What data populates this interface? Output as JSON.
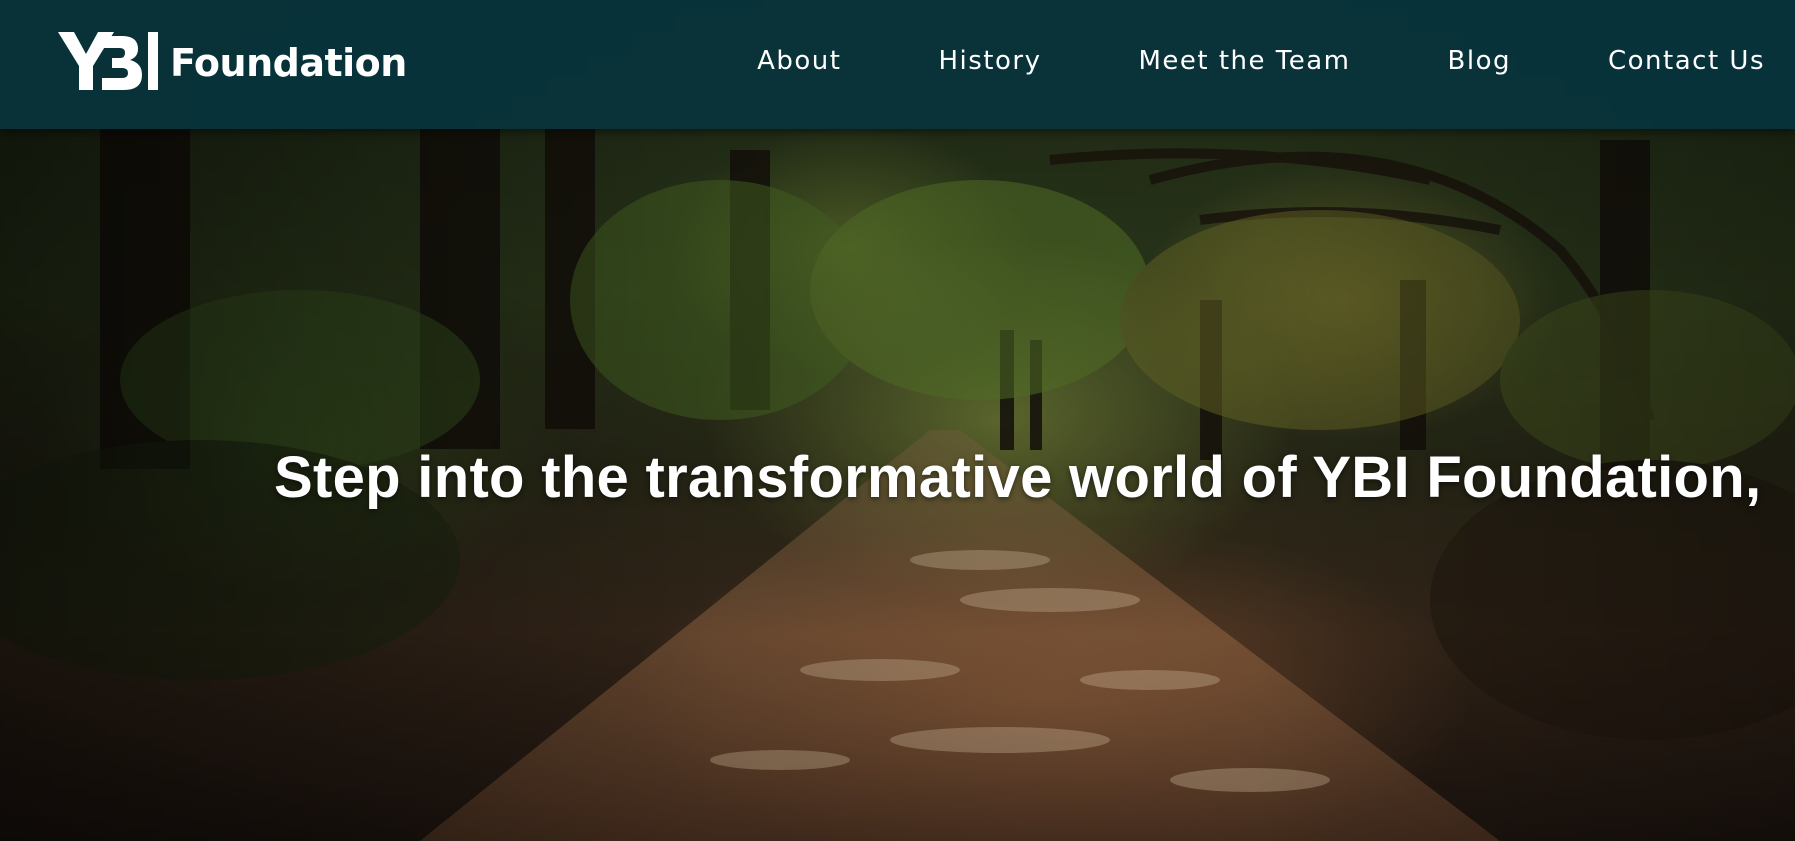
{
  "header": {
    "brand": {
      "logo_mark": "YBI",
      "name": "Foundation",
      "icon": "ybi-logo-icon"
    },
    "nav": [
      {
        "label": "About"
      },
      {
        "label": "History"
      },
      {
        "label": "Meet the Team"
      },
      {
        "label": "Blog"
      },
      {
        "label": "Contact Us"
      }
    ]
  },
  "hero": {
    "headline": "Step into the transformative world of YBI Foundation,",
    "background": "forest-path-image"
  },
  "colors": {
    "header_bg": "#08343c",
    "text": "#ffffff"
  }
}
